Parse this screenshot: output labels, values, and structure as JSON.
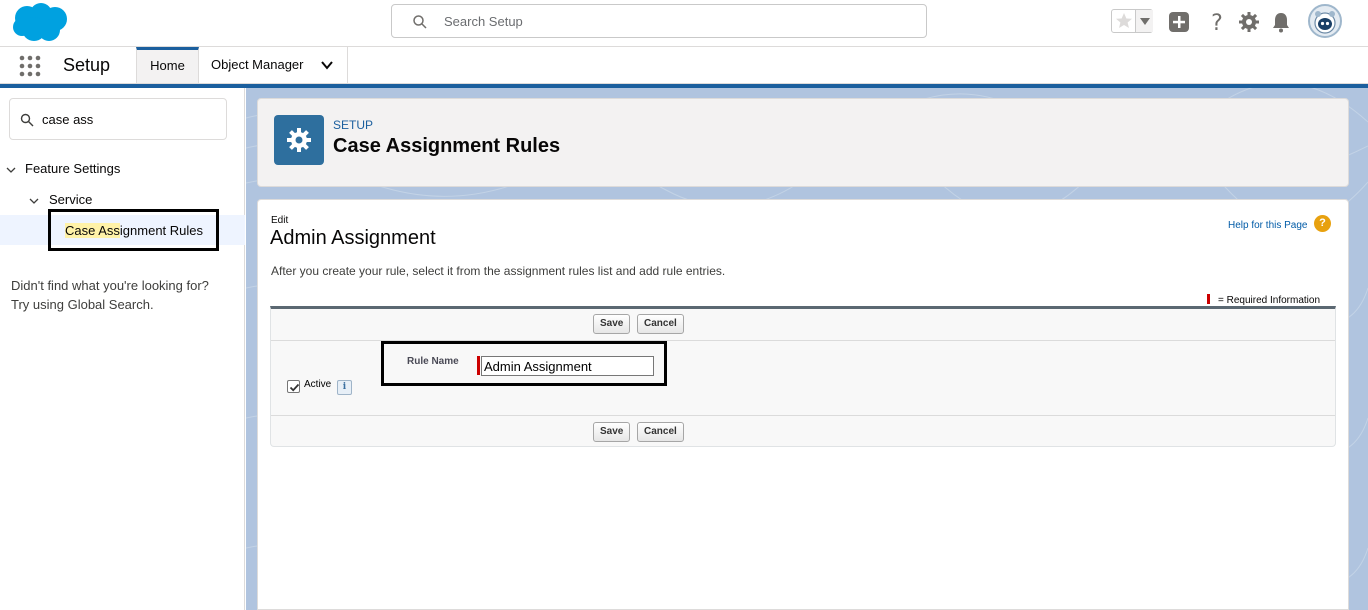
{
  "header": {
    "search_placeholder": "Search Setup"
  },
  "nav": {
    "app_name": "Setup",
    "tabs": [
      {
        "label": "Home",
        "active": true
      },
      {
        "label": "Object Manager",
        "active": false
      }
    ]
  },
  "sidebar": {
    "quick_find_value": "case ass",
    "tree": {
      "feature_settings": "Feature Settings",
      "service": "Service",
      "selected_item_match": "Case Ass",
      "selected_item_rest": "ignment Rules"
    },
    "not_found_line1": "Didn't find what you're looking for?",
    "not_found_line2": "Try using Global Search."
  },
  "page_header": {
    "eyebrow": "SETUP",
    "title": "Case Assignment Rules"
  },
  "main": {
    "edit_label": "Edit",
    "title": "Admin Assignment",
    "help_link": "Help for this Page",
    "help_icon": "?",
    "intro": "After you create your rule, select it from the assignment rules list and add rule entries.",
    "required_info": "= Required Information",
    "save_label": "Save",
    "cancel_label": "Cancel",
    "rule_name_label": "Rule Name",
    "rule_name_value": "Admin Assignment",
    "active_label": "Active",
    "active_checked": true,
    "info_icon": "i"
  },
  "colors": {
    "brand_blue": "#1b5f9e",
    "required_red": "#cc0000",
    "help_orange": "#e8a10f"
  }
}
